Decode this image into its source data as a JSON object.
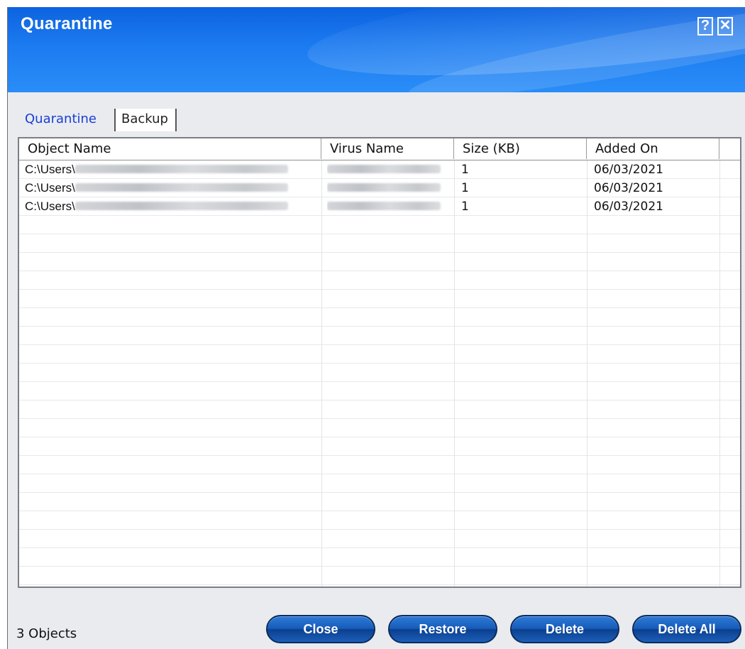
{
  "window": {
    "title": "Quarantine",
    "help_button": "?",
    "close_button": "✕"
  },
  "tabs": [
    {
      "label": "Quarantine",
      "active": true
    },
    {
      "label": "Backup",
      "active": false
    }
  ],
  "table": {
    "columns": [
      "Object Name",
      "Virus Name",
      "Size (KB)",
      "Added On"
    ],
    "rows": [
      {
        "object_name": "C:\\Users\\",
        "virus_name": "",
        "size_kb": "1",
        "added_on": "06/03/2021"
      },
      {
        "object_name": "C:\\Users\\",
        "virus_name": "",
        "size_kb": "1",
        "added_on": "06/03/2021"
      },
      {
        "object_name": "C:\\Users\\",
        "virus_name": "",
        "size_kb": "1",
        "added_on": "06/03/2021"
      }
    ]
  },
  "status": {
    "count_text": "3 Objects"
  },
  "buttons": {
    "close": "Close",
    "restore": "Restore",
    "delete": "Delete",
    "delete_all": "Delete All"
  },
  "colors": {
    "titlebar": "#1c7bf0",
    "active_tab_text": "#1a3ed6",
    "button": "#175bb8"
  }
}
